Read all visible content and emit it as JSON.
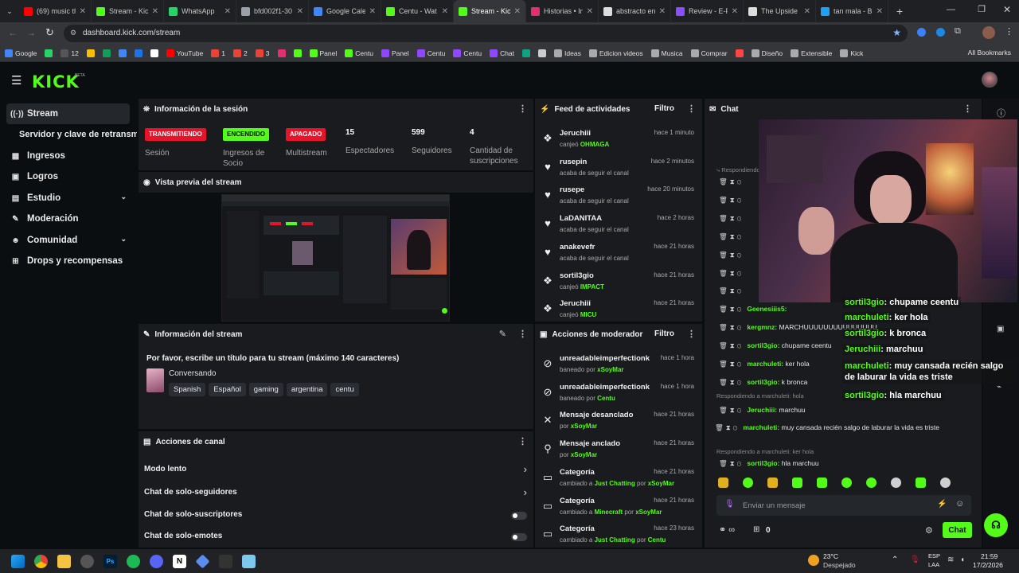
{
  "browser": {
    "tabs": [
      {
        "title": "(69) music th",
        "color": "#ff0000",
        "active": false
      },
      {
        "title": "Stream - Kick",
        "color": "#53fc18",
        "active": false
      },
      {
        "title": "WhatsApp",
        "color": "#25d366",
        "active": false
      },
      {
        "title": "bfd002f1-30",
        "color": "#9aa0a6",
        "active": false
      },
      {
        "title": "Google Calen",
        "color": "#4285f4",
        "active": false
      },
      {
        "title": "Centu - Wat",
        "color": "#53fc18",
        "active": false
      },
      {
        "title": "Stream - Kick",
        "color": "#53fc18",
        "active": true
      },
      {
        "title": "Historias • In",
        "color": "#e1306c",
        "active": false
      },
      {
        "title": "abstracto en",
        "color": "#dddddd",
        "active": false
      },
      {
        "title": "Review - E-P",
        "color": "#8a4fff",
        "active": false
      },
      {
        "title": "The Upside D",
        "color": "#dddddd",
        "active": false
      },
      {
        "title": "tan mala - B",
        "color": "#1da1f2",
        "active": false
      }
    ],
    "url": "dashboard.kick.com/stream",
    "bookmarks": [
      {
        "label": "Google",
        "color": "#4285f4"
      },
      {
        "label": "",
        "color": "#25d366"
      },
      {
        "label": "12",
        "color": "#555555"
      },
      {
        "label": "",
        "color": "#fbbc04"
      },
      {
        "label": "",
        "color": "#0f9d58"
      },
      {
        "label": "",
        "color": "#4285f4"
      },
      {
        "label": "",
        "color": "#1a73e8"
      },
      {
        "label": "",
        "color": "#ffffff"
      },
      {
        "label": "YouTube",
        "color": "#ff0000"
      },
      {
        "label": "1",
        "color": "#ea4335"
      },
      {
        "label": "2",
        "color": "#ea4335"
      },
      {
        "label": "3",
        "color": "#ea4335"
      },
      {
        "label": "",
        "color": "#e1306c"
      },
      {
        "label": "",
        "color": "#53fc18"
      },
      {
        "label": "Panel",
        "color": "#53fc18"
      },
      {
        "label": "Centu",
        "color": "#53fc18"
      },
      {
        "label": "Panel",
        "color": "#9146ff"
      },
      {
        "label": "Centu",
        "color": "#9146ff"
      },
      {
        "label": "Centu",
        "color": "#9146ff"
      },
      {
        "label": "Chat",
        "color": "#9146ff"
      },
      {
        "label": "",
        "color": "#10a37f"
      },
      {
        "label": "",
        "color": "#cccccc"
      },
      {
        "label": "Ideas",
        "color": "#aaaaaa"
      },
      {
        "label": "Edicion videos",
        "color": "#aaaaaa"
      },
      {
        "label": "Musica",
        "color": "#aaaaaa"
      },
      {
        "label": "Comprar",
        "color": "#aaaaaa"
      },
      {
        "label": "",
        "color": "#ff4444"
      },
      {
        "label": "Diseño",
        "color": "#aaaaaa"
      },
      {
        "label": "Extensible",
        "color": "#aaaaaa"
      },
      {
        "label": "Kick",
        "color": "#aaaaaa"
      }
    ],
    "all_bookmarks": "All Bookmarks"
  },
  "kick": {
    "logo": "KICK",
    "beta": "BETA"
  },
  "sidebar": {
    "items": [
      {
        "label": "Stream",
        "icon": "broadcast-icon",
        "glyph": "((·))",
        "active": true
      },
      {
        "label": "Servidor y clave de retransmisión",
        "icon": "",
        "glyph": "",
        "active": false
      },
      {
        "label": "Ingresos",
        "icon": "money-icon",
        "glyph": "▦",
        "active": false
      },
      {
        "label": "Logros",
        "icon": "trophy-icon",
        "glyph": "▣",
        "active": false
      },
      {
        "label": "Estudio",
        "icon": "studio-icon",
        "glyph": "▤",
        "active": false,
        "chevron": true
      },
      {
        "label": "Moderación",
        "icon": "wrench-icon",
        "glyph": "✎",
        "active": false
      },
      {
        "label": "Comunidad",
        "icon": "community-icon",
        "glyph": "☻",
        "active": false,
        "chevron": true
      },
      {
        "label": "Drops y recompensas",
        "icon": "drops-icon",
        "glyph": "⊞",
        "active": false
      }
    ]
  },
  "session": {
    "title": "Información de la sesión",
    "badges": [
      {
        "text": "TRANSMITIENDO",
        "label": "Sesión",
        "bg": "#e5142a",
        "fg": "#ffffff"
      },
      {
        "text": "ENCENDIDO",
        "label": "Ingresos de Socio",
        "bg": "#53fc18",
        "fg": "#0b0e11"
      },
      {
        "text": "APAGADO",
        "label": "Multistream",
        "bg": "#e5142a",
        "fg": "#ffffff"
      }
    ],
    "stats": [
      {
        "value": "15",
        "label": "Espectadores"
      },
      {
        "value": "599",
        "label": "Seguidores"
      },
      {
        "value": "4",
        "label": "Cantidad de suscripciones"
      }
    ]
  },
  "preview": {
    "title": "Vista previa del stream"
  },
  "stream_info": {
    "title": "Información del stream",
    "stream_title": "Por favor, escribe un título para tu stream (máximo 140 caracteres)",
    "category": "Conversando",
    "tags": [
      "Spanish",
      "Español",
      "gaming",
      "argentina",
      "centu"
    ]
  },
  "channel_actions": {
    "title": "Acciones de canal",
    "rows": [
      {
        "label": "Modo lento",
        "kind": "arrow"
      },
      {
        "label": "Chat de solo-seguidores",
        "kind": "arrow"
      },
      {
        "label": "Chat de solo-suscriptores",
        "kind": "toggle"
      },
      {
        "label": "Chat de solo-emotes",
        "kind": "toggle"
      }
    ]
  },
  "activity": {
    "title": "Feed de actividades",
    "filter": "Filtro",
    "items": [
      {
        "icon": "gift-icon",
        "glyph": "❖",
        "name": "Jeruchiii",
        "prefix": "canjeó",
        "highlight": "OHMAGA",
        "time": "hace 1 minuto"
      },
      {
        "icon": "heart-icon",
        "glyph": "♥",
        "name": "rusepin",
        "prefix": "acaba de seguir el canal",
        "highlight": "",
        "time": "hace 2 minutos"
      },
      {
        "icon": "heart-icon",
        "glyph": "♥",
        "name": "rusepe",
        "prefix": "acaba de seguir el canal",
        "highlight": "",
        "time": "hace 20 minutos"
      },
      {
        "icon": "heart-icon",
        "glyph": "♥",
        "name": "LaDANITAA",
        "prefix": "acaba de seguir el canal",
        "highlight": "",
        "time": "hace 2 horas"
      },
      {
        "icon": "heart-icon",
        "glyph": "♥",
        "name": "anakevefr",
        "prefix": "acaba de seguir el canal",
        "highlight": "",
        "time": "hace 21 horas"
      },
      {
        "icon": "gift-icon",
        "glyph": "❖",
        "name": "sortil3gio",
        "prefix": "canjeó",
        "highlight": "IMPACT",
        "time": "hace 21 horas"
      },
      {
        "icon": "gift-icon",
        "glyph": "❖",
        "name": "Jeruchiii",
        "prefix": "canjeó",
        "highlight": "MICU",
        "time": "hace 21 horas"
      }
    ]
  },
  "mod_actions": {
    "title": "Acciones de moderador",
    "filter": "Filtro",
    "items": [
      {
        "icon": "ban-icon",
        "glyph": "⊘",
        "name": "unreadableimperfectionk",
        "prefix": "baneado por",
        "highlight": "xSoyMar",
        "time": "hace 1 hora"
      },
      {
        "icon": "ban-icon",
        "glyph": "⊘",
        "name": "unreadableimperfectionk",
        "prefix": "baneado por",
        "highlight": "Centu",
        "time": "hace 1 hora"
      },
      {
        "icon": "unpin-icon",
        "glyph": "✕",
        "name": "Mensaje desanclado",
        "prefix": "por",
        "highlight": "xSoyMar",
        "time": "hace 21 horas"
      },
      {
        "icon": "pin-icon",
        "glyph": "⚲",
        "name": "Mensaje anclado",
        "prefix": "por",
        "highlight": "xSoyMar",
        "time": "hace 21 horas"
      },
      {
        "icon": "category-icon",
        "glyph": "▭",
        "name": "Categoría",
        "prefix": "cambiado a",
        "highlight": "Just Chatting",
        "suffix": "por",
        "by": "xSoyMar",
        "time": "hace 21 horas"
      },
      {
        "icon": "category-icon",
        "glyph": "▭",
        "name": "Categoría",
        "prefix": "cambiado a",
        "highlight": "Minecraft",
        "suffix": "por",
        "by": "xSoyMar",
        "time": "hace 21 horas"
      },
      {
        "icon": "category-icon",
        "glyph": "▭",
        "name": "Categoría",
        "prefix": "cambiado a",
        "highlight": "Just Chatting",
        "suffix": "por",
        "by": "Centu",
        "time": "hace 23 horas"
      }
    ]
  },
  "chat": {
    "title": "Chat",
    "reply_top": "Respondiendo",
    "messages": [
      {
        "user": "Geenesiiis5:",
        "text": "",
        "reply": ""
      },
      {
        "user": "kergmnz:",
        "text": "MARCHUUUUUUUUUUUUUUU",
        "reply": ""
      },
      {
        "user": "sortil3gio:",
        "text": "chupame ceentu",
        "reply": ""
      },
      {
        "user": "marchuleti:",
        "text": "ker hola",
        "reply": ""
      },
      {
        "user": "sortil3gio:",
        "text": "k bronca",
        "reply": ""
      },
      {
        "user": "Jeruchiii:",
        "text": "marchuu",
        "reply": "Respondiendo a marchuleti: hola"
      },
      {
        "user": "marchuleti:",
        "text": "muy cansada recién salgo de laburar la vida es triste",
        "reply": ""
      },
      {
        "user": "sortil3gio:",
        "text": "hla marchuu",
        "reply": "Respondiendo a marchuleti: ker hola"
      }
    ],
    "input_placeholder": "Enviar un mensaje",
    "send_label": "Chat",
    "viewers_value": "0"
  },
  "overlay_chat": [
    {
      "user": "sortil3gio",
      "text": ": chupame ceentu"
    },
    {
      "user": "marchuleti",
      "text": ": ker hola"
    },
    {
      "user": "sortil3gio",
      "text": ": k bronca"
    },
    {
      "user": "Jeruchiii",
      "text": ": marchuu"
    },
    {
      "user": "marchuleti",
      "text": ": muy cansada recién salgo de laburar la vida es triste"
    },
    {
      "user": "sortil3gio",
      "text": ": hla marchuu"
    }
  ],
  "taskbar": {
    "weather_temp": "23°C",
    "weather_desc": "Despejado",
    "lang_top": "ESP",
    "lang_bottom": "LAA",
    "time": "21:59",
    "date": "17/2/2026"
  }
}
